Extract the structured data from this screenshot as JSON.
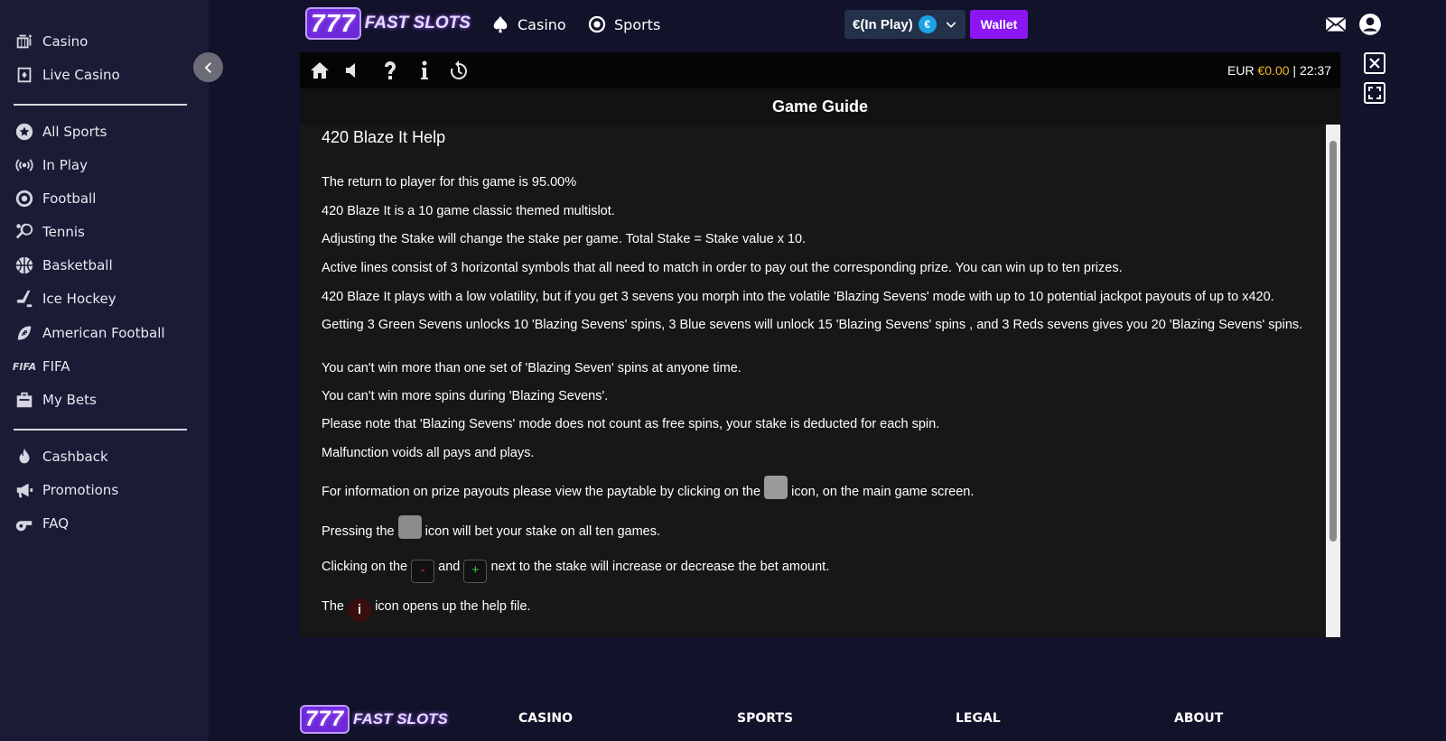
{
  "brand": {
    "logo_number": "777",
    "logo_word": "FAST SLOTS"
  },
  "sidebar": {
    "items": [
      {
        "label": "Casino",
        "icon": "casino-icon"
      },
      {
        "label": "Live Casino",
        "icon": "cards-icon"
      },
      {
        "label": "All Sports",
        "icon": "star-icon"
      },
      {
        "label": "In Play",
        "icon": "broadcast-icon"
      },
      {
        "label": "Football",
        "icon": "football-icon"
      },
      {
        "label": "Tennis",
        "icon": "tennis-icon"
      },
      {
        "label": "Basketball",
        "icon": "basketball-icon"
      },
      {
        "label": "Ice Hockey",
        "icon": "hockey-icon"
      },
      {
        "label": "American Football",
        "icon": "american-football-icon"
      },
      {
        "label": "FIFA",
        "icon": "fifa-icon"
      },
      {
        "label": "My Bets",
        "icon": "bets-icon"
      },
      {
        "label": "Cashback",
        "icon": "flame-icon"
      },
      {
        "label": "Promotions",
        "icon": "megaphone-icon"
      },
      {
        "label": "FAQ",
        "icon": "whistle-icon"
      }
    ],
    "fifa_badge": "FIFA"
  },
  "header": {
    "nav": [
      {
        "label": "Casino",
        "icon": "spade-icon"
      },
      {
        "label": "Sports",
        "icon": "ball-icon"
      }
    ],
    "balance_label": "€(In Play)",
    "currency_symbol": "€",
    "wallet_label": "Wallet"
  },
  "game": {
    "status_currency": "EUR",
    "status_amount": "€0.00",
    "status_sep": "|",
    "status_time": "22:37",
    "guide_header": "Game Guide",
    "guide_title": "420 Blaze It Help",
    "paragraphs": [
      "The return to player for this game is 95.00%",
      "420 Blaze It is a 10 game classic themed multislot.",
      "Adjusting the Stake will change the stake per game. Total Stake = Stake value x 10.",
      "Active lines consist of 3 horizontal symbols that all need to match in order to pay out the corresponding prize. You can win up to ten prizes.",
      "420 Blaze It plays with a low volatility, but if you get 3 sevens you morph into the volatile 'Blazing Sevens' mode with up to 10 potential jackpot payouts of up to x420.",
      "Getting 3 Green Sevens unlocks 10 'Blazing Sevens' spins, 3 Blue sevens will unlock 15 'Blazing Sevens' spins , and 3 Reds sevens gives you 20 'Blazing Sevens' spins.",
      "You can't win more than one set of 'Blazing Seven' spins at anyone time.",
      "You can't win more spins during 'Blazing Sevens'.",
      "Please note that 'Blazing Sevens' mode does not count as free spins, your stake is deducted for each spin.",
      "Malfunction voids all pays and plays."
    ],
    "paytable_pre": "For information on prize payouts please view the paytable by clicking on the",
    "paytable_post": "icon, on the main game screen.",
    "pressing_pre": "Pressing the",
    "pressing_post": "icon will bet your stake on all ten games.",
    "clicking_pre": "Clicking on the",
    "clicking_and": "and",
    "clicking_post": "next to the stake will increase or decrease the bet amount.",
    "the_pre": "The",
    "the_post": "icon opens up the help file."
  },
  "footer": {
    "columns": [
      "CASINO",
      "SPORTS",
      "LEGAL",
      "ABOUT"
    ]
  }
}
